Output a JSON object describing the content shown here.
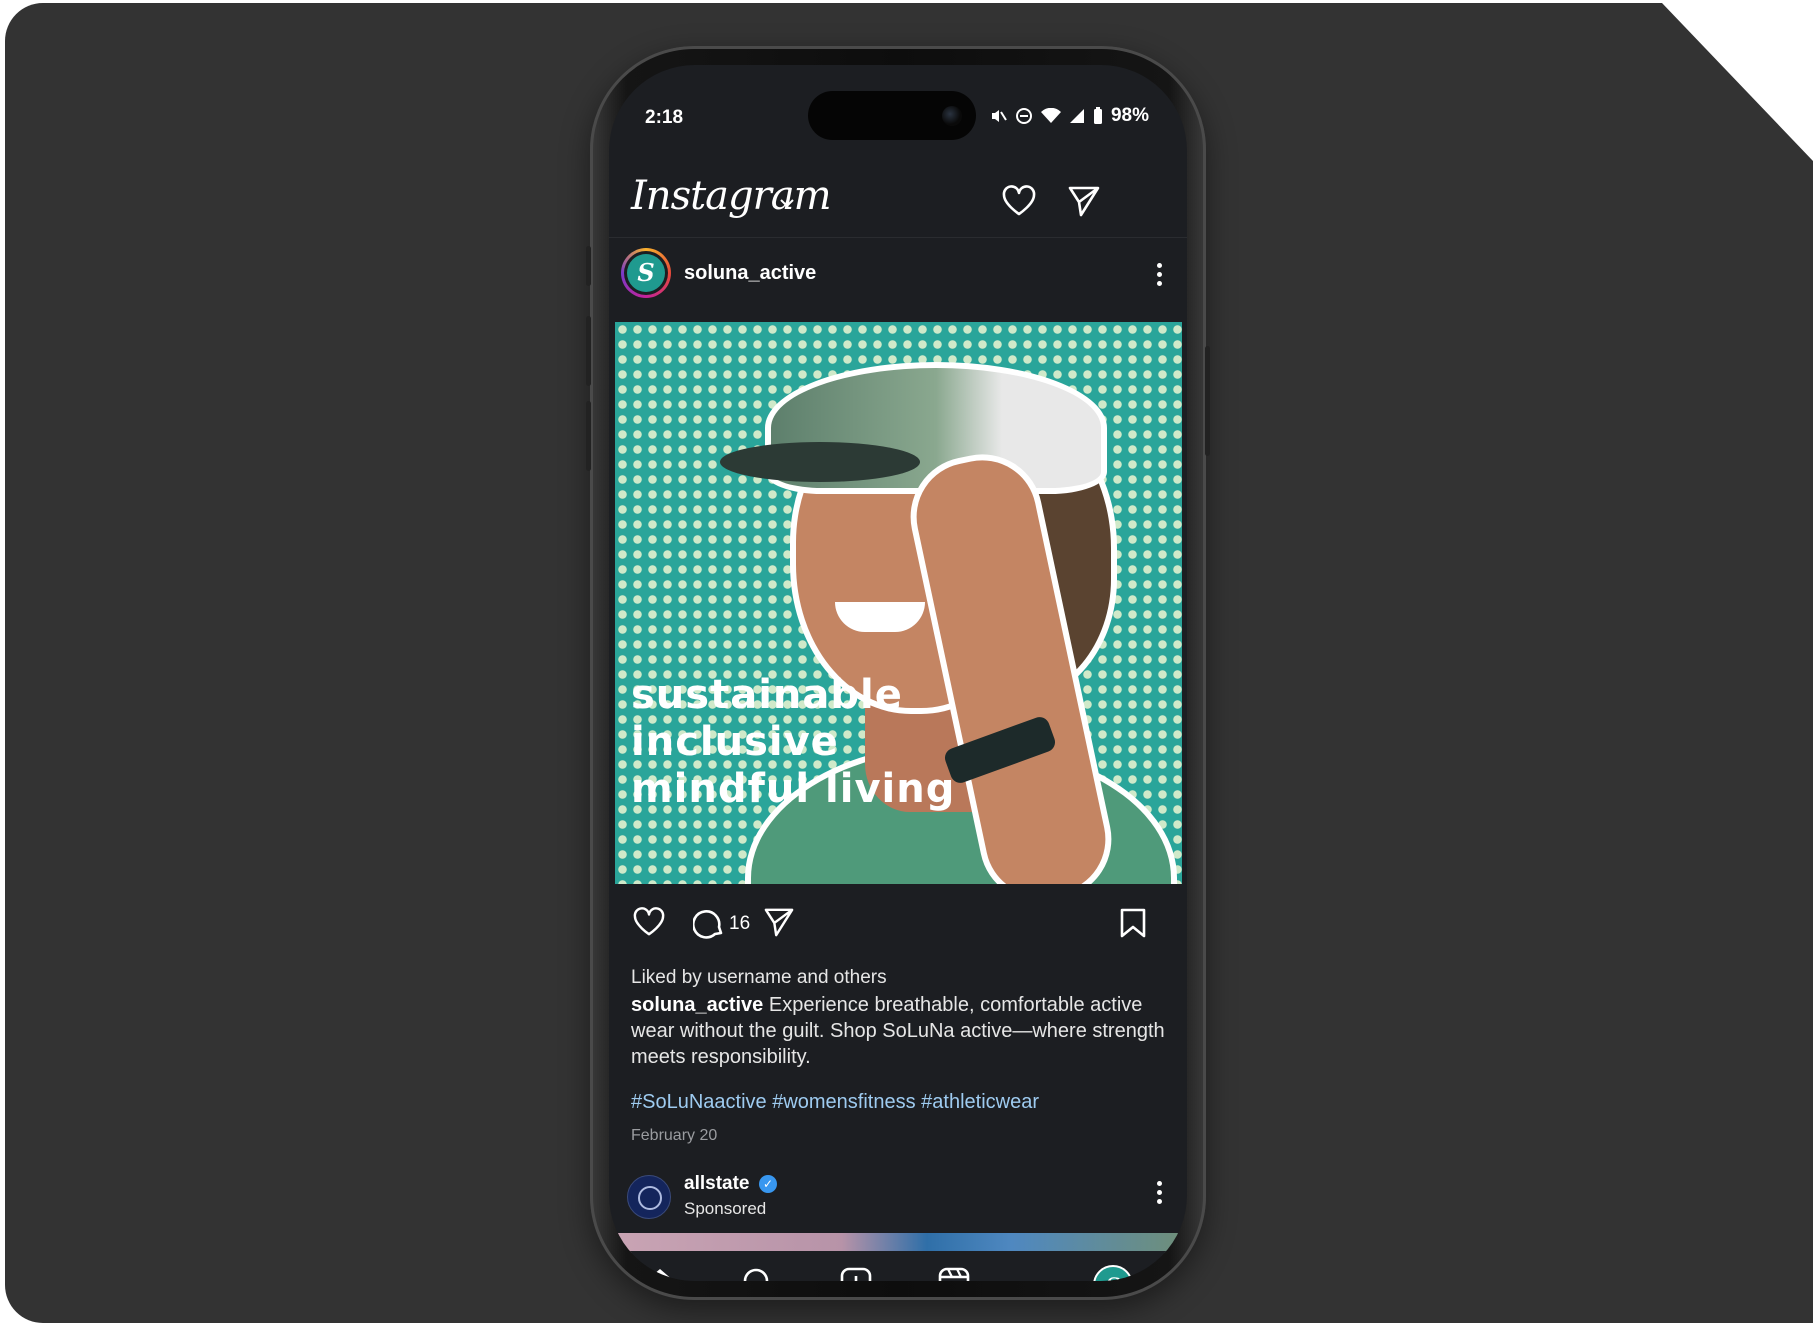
{
  "status_bar": {
    "time": "2:18",
    "battery": "98%"
  },
  "header": {
    "logo": "Instagram",
    "icons": [
      "chevron-down-icon",
      "heart-icon",
      "send-icon"
    ]
  },
  "post": {
    "username": "soluna_active",
    "avatar_letter": "S",
    "image_text": [
      "sustainable",
      "inclusive",
      "mindful living"
    ],
    "comment_count": "16",
    "liked_by": "Liked by username and others",
    "caption_user": "soluna_active",
    "caption_text": " Experience breathable, comfortable active wear without the guilt. Shop SoLuNa active—where strength meets responsibility.",
    "hashtags": "#SoLuNaactive #womensfitness #athleticwear",
    "date": "February 20"
  },
  "sponsored_post": {
    "username": "allstate",
    "label": "Sponsored"
  },
  "tabbar": {
    "items": [
      "home-icon",
      "search-icon",
      "create-icon",
      "reels-icon",
      "profile-avatar"
    ],
    "avatar_letter": "S"
  },
  "colors": {
    "background": "#333333",
    "screen": "#1c1e22",
    "image_teal": "#2aa59a",
    "hashtag": "#9ecbf0",
    "verified": "#3897f0"
  }
}
